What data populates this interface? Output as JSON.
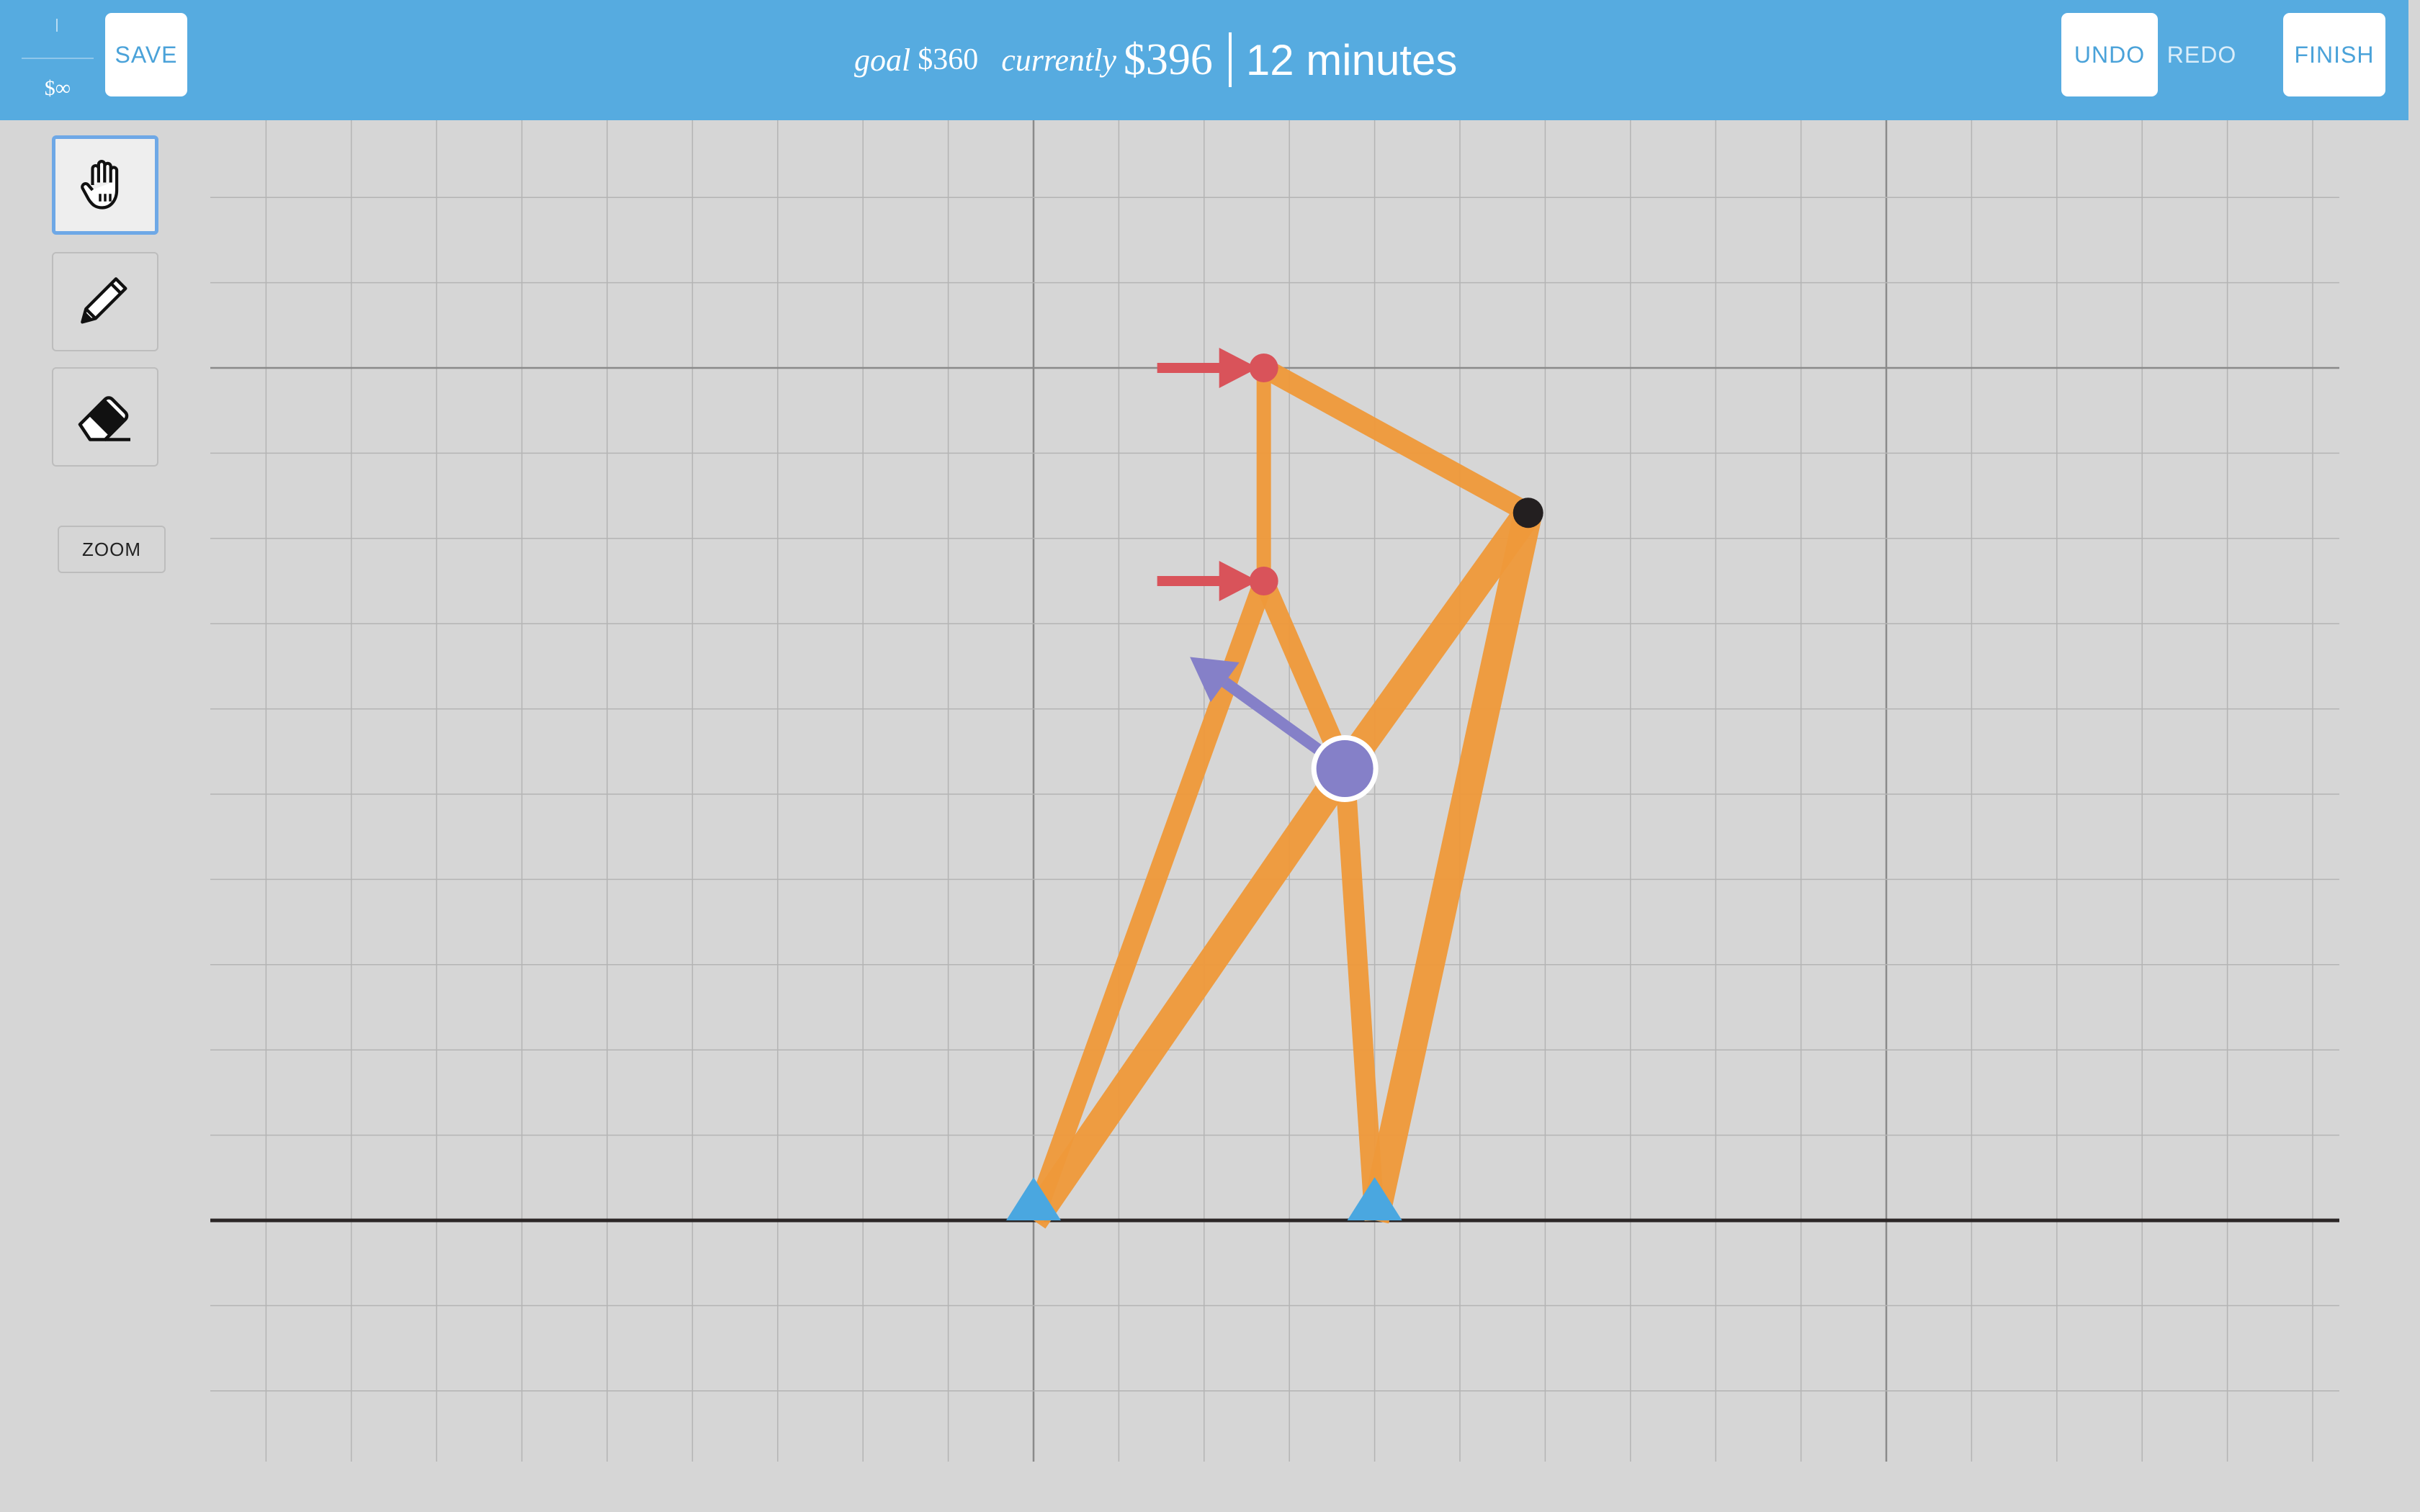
{
  "toolbar": {
    "budget_label": "$∞",
    "save_label": "SAVE",
    "undo_label": "UNDO",
    "redo_label": "REDO",
    "finish_label": "FINISH"
  },
  "status": {
    "goal_label": "goal",
    "goal_value": "$360",
    "current_label": "currently",
    "current_value": "$396",
    "time": "12 minutes"
  },
  "tools": [
    {
      "name": "hand",
      "icon": "hand-icon",
      "active": true
    },
    {
      "name": "pencil",
      "icon": "pencil-icon",
      "active": false
    },
    {
      "name": "eraser",
      "icon": "eraser-icon",
      "active": false
    }
  ],
  "zoom_label": "ZOOM",
  "colors": {
    "header": "#56abe0",
    "member": "#f0993a",
    "load": "#d9535a",
    "support": "#4aa7e0",
    "free_joint": "#231f20",
    "loaded_joint": "#8580c8",
    "background": "#d6d6d6"
  },
  "structure": {
    "joints": [
      {
        "id": "A",
        "x": 0,
        "y": 0,
        "type": "support"
      },
      {
        "id": "B",
        "x": 4,
        "y": 0,
        "type": "support"
      },
      {
        "id": "C",
        "x": 2.7,
        "y": 10,
        "type": "load"
      },
      {
        "id": "D",
        "x": 2.7,
        "y": 7.5,
        "type": "load"
      },
      {
        "id": "E",
        "x": 5.8,
        "y": 8.3,
        "type": "free"
      },
      {
        "id": "F",
        "x": 3.65,
        "y": 5.3,
        "type": "target"
      }
    ],
    "members": [
      {
        "from": "C",
        "to": "D",
        "weight": "thin"
      },
      {
        "from": "C",
        "to": "E",
        "weight": "medium"
      },
      {
        "from": "D",
        "to": "A",
        "weight": "medium"
      },
      {
        "from": "D",
        "to": "F",
        "weight": "medium"
      },
      {
        "from": "E",
        "to": "F",
        "weight": "thick"
      },
      {
        "from": "F",
        "to": "A",
        "weight": "thick"
      },
      {
        "from": "F",
        "to": "B",
        "weight": "medium"
      },
      {
        "from": "E",
        "to": "B",
        "weight": "thick"
      }
    ],
    "loads": [
      {
        "joint": "C",
        "direction": "right"
      },
      {
        "joint": "D",
        "direction": "right"
      },
      {
        "joint": "F",
        "direction": "up-left"
      }
    ]
  }
}
